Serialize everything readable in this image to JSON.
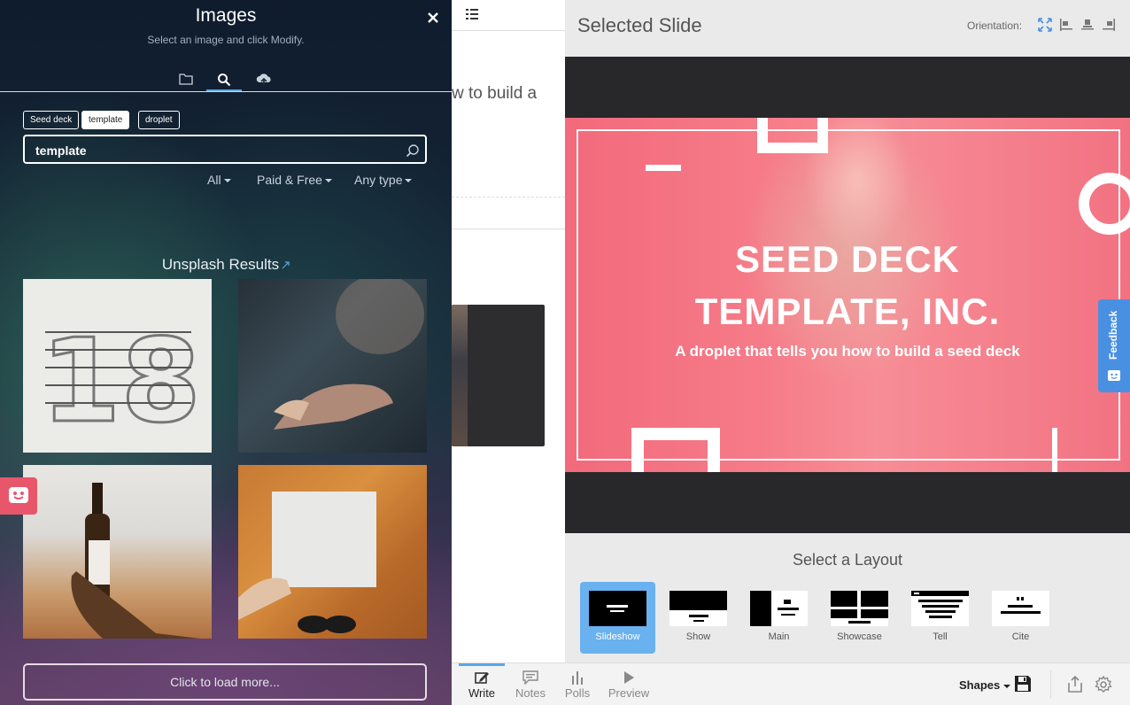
{
  "image_panel": {
    "title": "Images",
    "subtitle": "Select an image and click Modify.",
    "tabs": [
      "folder-icon",
      "search-icon",
      "cloud-upload-icon"
    ],
    "active_tab": "search",
    "tags": [
      {
        "label": "Seed deck",
        "active": false
      },
      {
        "label": "template",
        "active": true
      },
      {
        "label": "droplet",
        "active": false
      }
    ],
    "search_value": "template",
    "filters": [
      "All",
      "Paid & Free",
      "Any type"
    ],
    "results_heading": "Unsplash Results",
    "load_more": "Click to load more..."
  },
  "editor": {
    "fragment_1": ".",
    "fragment_2": "w to build a"
  },
  "selected_slide": {
    "heading": "Selected Slide",
    "orientation_label": "Orientation:",
    "slide_title_line1": "SEED DECK",
    "slide_title_line2": "TEMPLATE, INC.",
    "slide_subtitle": "A droplet that tells you how to build a seed deck"
  },
  "feedback": {
    "label": "Feedback"
  },
  "layouts": {
    "heading": "Select a Layout",
    "items": [
      {
        "label": "Slideshow",
        "active": true
      },
      {
        "label": "Show",
        "active": false
      },
      {
        "label": "Main",
        "active": false
      },
      {
        "label": "Showcase",
        "active": false
      },
      {
        "label": "Tell",
        "active": false
      },
      {
        "label": "Cite",
        "active": false
      }
    ]
  },
  "bottom_bar": {
    "tabs": [
      {
        "label": "Write",
        "active": true
      },
      {
        "label": "Notes",
        "active": false
      },
      {
        "label": "Polls",
        "active": false
      },
      {
        "label": "Preview",
        "active": false
      }
    ],
    "shapes_label": "Shapes"
  },
  "colors": {
    "accent": "#5aa7e8",
    "slide_overlay": "#f26a7c",
    "feedback_tab": "#4a90e2",
    "smiley_tab": "#e8566c"
  }
}
